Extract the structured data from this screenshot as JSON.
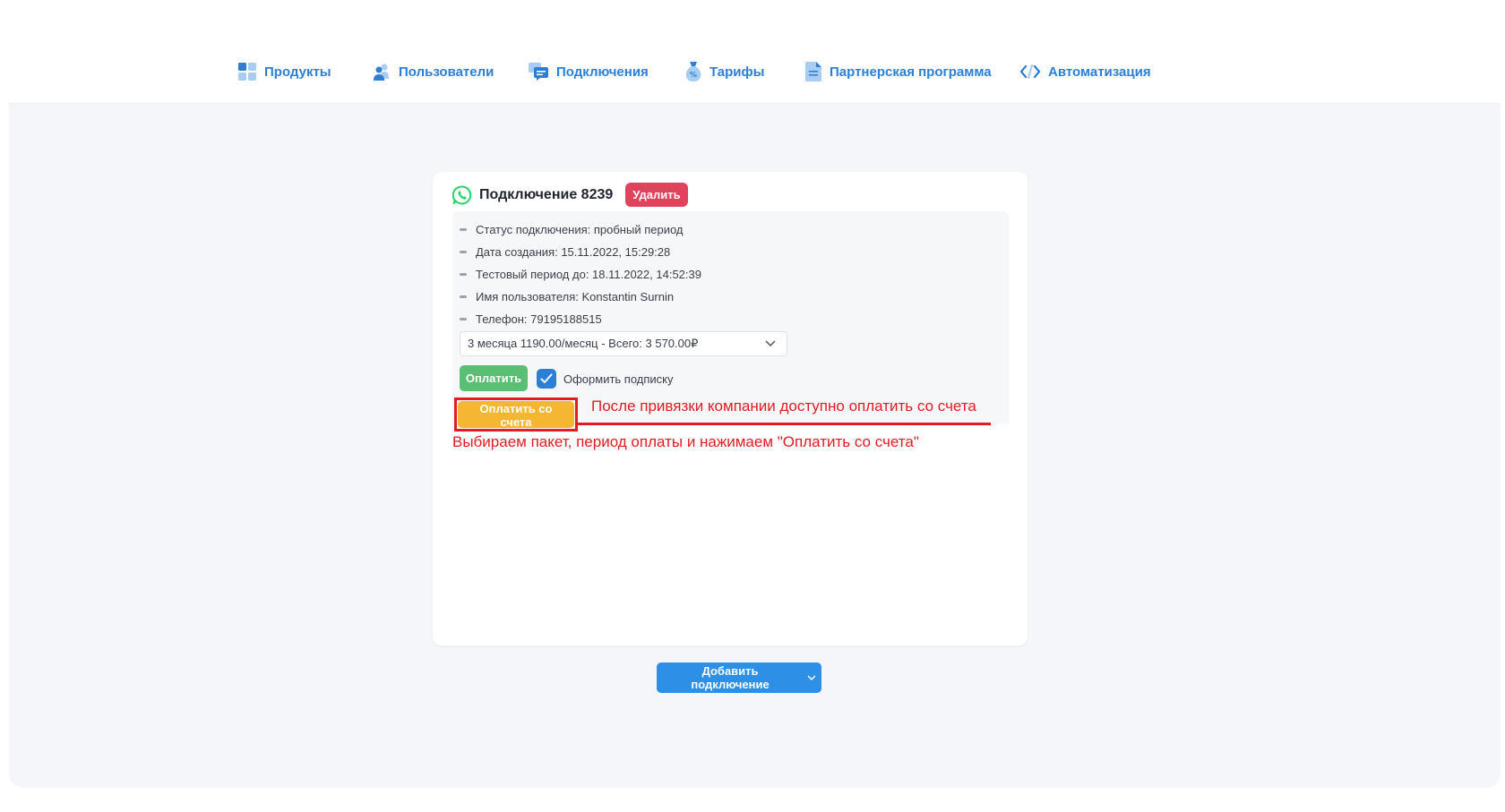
{
  "nav": {
    "items": [
      {
        "label": "Продукты",
        "icon": "grid-icon"
      },
      {
        "label": "Пользователи",
        "icon": "users-icon"
      },
      {
        "label": "Подключения",
        "icon": "chat-icon"
      },
      {
        "label": "Тарифы",
        "icon": "tag-icon"
      },
      {
        "label": "Партнерская программа",
        "icon": "document-icon"
      },
      {
        "label": "Автоматизация",
        "icon": "code-icon"
      }
    ]
  },
  "connection": {
    "title": "Подключение 8239",
    "delete_label": "Удалить",
    "info": [
      "Статус подключения: пробный период",
      "Дата создания: 15.11.2022, 15:29:28",
      "Тестовый период до: 18.11.2022, 14:52:39",
      "Имя пользователя: Konstantin Surnin",
      "Телефон: 79195188515"
    ],
    "plan_selected": "3 месяца 1190.00/месяц - Всего: 3 570.00₽",
    "pay_label": "Оплатить",
    "subscribe_label": "Оформить подписку",
    "subscribe_checked": true,
    "pay_account_label": "Оплатить со счета"
  },
  "annotations": {
    "note1": "После привязки компании доступно оплатить со счета",
    "note2": "Выбираем пакет, период оплаты и нажимаем \"Оплатить со счета\""
  },
  "add_connection_label": "Добавить подключение",
  "colors": {
    "accent": "#2d7fd6",
    "danger": "#e0445c",
    "success": "#5bbf73",
    "warning": "#f5b731",
    "annotation": "#e31b23",
    "whatsapp": "#25d366"
  }
}
